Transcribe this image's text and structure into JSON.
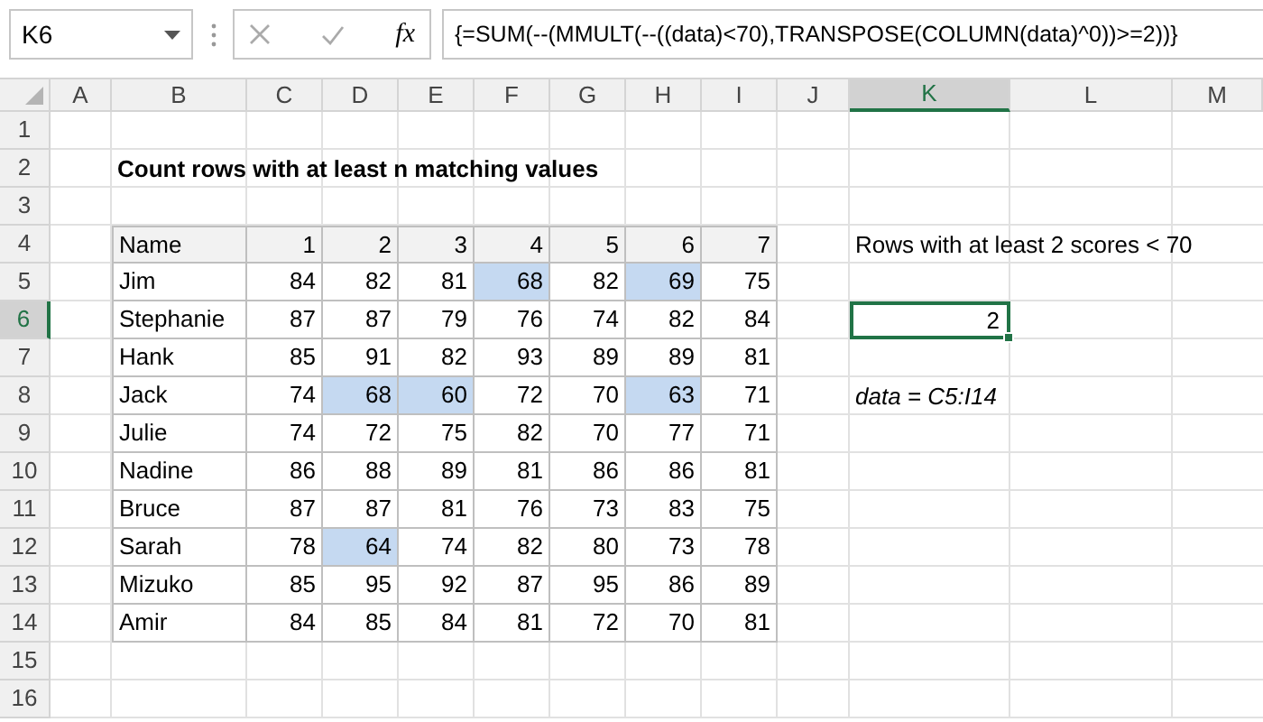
{
  "name_box": "K6",
  "function_label": "fx",
  "formula": "{=SUM(--(MMULT(--((data)<70),TRANSPOSE(COLUMN(data)^0))>=2))}",
  "columns": [
    {
      "label": "A",
      "selected": false
    },
    {
      "label": "B",
      "selected": false
    },
    {
      "label": "C",
      "selected": false
    },
    {
      "label": "D",
      "selected": false
    },
    {
      "label": "E",
      "selected": false
    },
    {
      "label": "F",
      "selected": false
    },
    {
      "label": "G",
      "selected": false
    },
    {
      "label": "H",
      "selected": false
    },
    {
      "label": "I",
      "selected": false
    },
    {
      "label": "J",
      "selected": false
    },
    {
      "label": "K",
      "selected": true
    },
    {
      "label": "L",
      "selected": false
    },
    {
      "label": "M",
      "selected": false
    }
  ],
  "rows": [
    {
      "label": "1",
      "selected": false
    },
    {
      "label": "2",
      "selected": false
    },
    {
      "label": "3",
      "selected": false
    },
    {
      "label": "4",
      "selected": false
    },
    {
      "label": "5",
      "selected": false
    },
    {
      "label": "6",
      "selected": true
    },
    {
      "label": "7",
      "selected": false
    },
    {
      "label": "8",
      "selected": false
    },
    {
      "label": "9",
      "selected": false
    },
    {
      "label": "10",
      "selected": false
    },
    {
      "label": "11",
      "selected": false
    },
    {
      "label": "12",
      "selected": false
    },
    {
      "label": "13",
      "selected": false
    },
    {
      "label": "14",
      "selected": false
    },
    {
      "label": "15",
      "selected": false
    },
    {
      "label": "16",
      "selected": false
    }
  ],
  "title": "Count rows with at least n matching values",
  "table": {
    "header": [
      "Name",
      "1",
      "2",
      "3",
      "4",
      "5",
      "6",
      "7"
    ],
    "rows": [
      {
        "name": "Jim",
        "scores": [
          {
            "value": "84",
            "highlighted": false
          },
          {
            "value": "82",
            "highlighted": false
          },
          {
            "value": "81",
            "highlighted": false
          },
          {
            "value": "68",
            "highlighted": true
          },
          {
            "value": "82",
            "highlighted": false
          },
          {
            "value": "69",
            "highlighted": true
          },
          {
            "value": "75",
            "highlighted": false
          }
        ]
      },
      {
        "name": "Stephanie",
        "scores": [
          {
            "value": "87",
            "highlighted": false
          },
          {
            "value": "87",
            "highlighted": false
          },
          {
            "value": "79",
            "highlighted": false
          },
          {
            "value": "76",
            "highlighted": false
          },
          {
            "value": "74",
            "highlighted": false
          },
          {
            "value": "82",
            "highlighted": false
          },
          {
            "value": "84",
            "highlighted": false
          }
        ]
      },
      {
        "name": "Hank",
        "scores": [
          {
            "value": "85",
            "highlighted": false
          },
          {
            "value": "91",
            "highlighted": false
          },
          {
            "value": "82",
            "highlighted": false
          },
          {
            "value": "93",
            "highlighted": false
          },
          {
            "value": "89",
            "highlighted": false
          },
          {
            "value": "89",
            "highlighted": false
          },
          {
            "value": "81",
            "highlighted": false
          }
        ]
      },
      {
        "name": "Jack",
        "scores": [
          {
            "value": "74",
            "highlighted": false
          },
          {
            "value": "68",
            "highlighted": true
          },
          {
            "value": "60",
            "highlighted": true
          },
          {
            "value": "72",
            "highlighted": false
          },
          {
            "value": "70",
            "highlighted": false
          },
          {
            "value": "63",
            "highlighted": true
          },
          {
            "value": "71",
            "highlighted": false
          }
        ]
      },
      {
        "name": "Julie",
        "scores": [
          {
            "value": "74",
            "highlighted": false
          },
          {
            "value": "72",
            "highlighted": false
          },
          {
            "value": "75",
            "highlighted": false
          },
          {
            "value": "82",
            "highlighted": false
          },
          {
            "value": "70",
            "highlighted": false
          },
          {
            "value": "77",
            "highlighted": false
          },
          {
            "value": "71",
            "highlighted": false
          }
        ]
      },
      {
        "name": "Nadine",
        "scores": [
          {
            "value": "86",
            "highlighted": false
          },
          {
            "value": "88",
            "highlighted": false
          },
          {
            "value": "89",
            "highlighted": false
          },
          {
            "value": "81",
            "highlighted": false
          },
          {
            "value": "86",
            "highlighted": false
          },
          {
            "value": "86",
            "highlighted": false
          },
          {
            "value": "81",
            "highlighted": false
          }
        ]
      },
      {
        "name": "Bruce",
        "scores": [
          {
            "value": "87",
            "highlighted": false
          },
          {
            "value": "87",
            "highlighted": false
          },
          {
            "value": "81",
            "highlighted": false
          },
          {
            "value": "76",
            "highlighted": false
          },
          {
            "value": "73",
            "highlighted": false
          },
          {
            "value": "83",
            "highlighted": false
          },
          {
            "value": "75",
            "highlighted": false
          }
        ]
      },
      {
        "name": "Sarah",
        "scores": [
          {
            "value": "78",
            "highlighted": false
          },
          {
            "value": "64",
            "highlighted": true
          },
          {
            "value": "74",
            "highlighted": false
          },
          {
            "value": "82",
            "highlighted": false
          },
          {
            "value": "80",
            "highlighted": false
          },
          {
            "value": "73",
            "highlighted": false
          },
          {
            "value": "78",
            "highlighted": false
          }
        ]
      },
      {
        "name": "Mizuko",
        "scores": [
          {
            "value": "85",
            "highlighted": false
          },
          {
            "value": "95",
            "highlighted": false
          },
          {
            "value": "92",
            "highlighted": false
          },
          {
            "value": "87",
            "highlighted": false
          },
          {
            "value": "95",
            "highlighted": false
          },
          {
            "value": "86",
            "highlighted": false
          },
          {
            "value": "89",
            "highlighted": false
          }
        ]
      },
      {
        "name": "Amir",
        "scores": [
          {
            "value": "84",
            "highlighted": false
          },
          {
            "value": "85",
            "highlighted": false
          },
          {
            "value": "84",
            "highlighted": false
          },
          {
            "value": "81",
            "highlighted": false
          },
          {
            "value": "72",
            "highlighted": false
          },
          {
            "value": "70",
            "highlighted": false
          },
          {
            "value": "81",
            "highlighted": false
          }
        ]
      }
    ]
  },
  "label": "Rows with at least 2 scores < 70",
  "result": {
    "value": "2",
    "selected": true
  },
  "note": "data = C5:I14"
}
